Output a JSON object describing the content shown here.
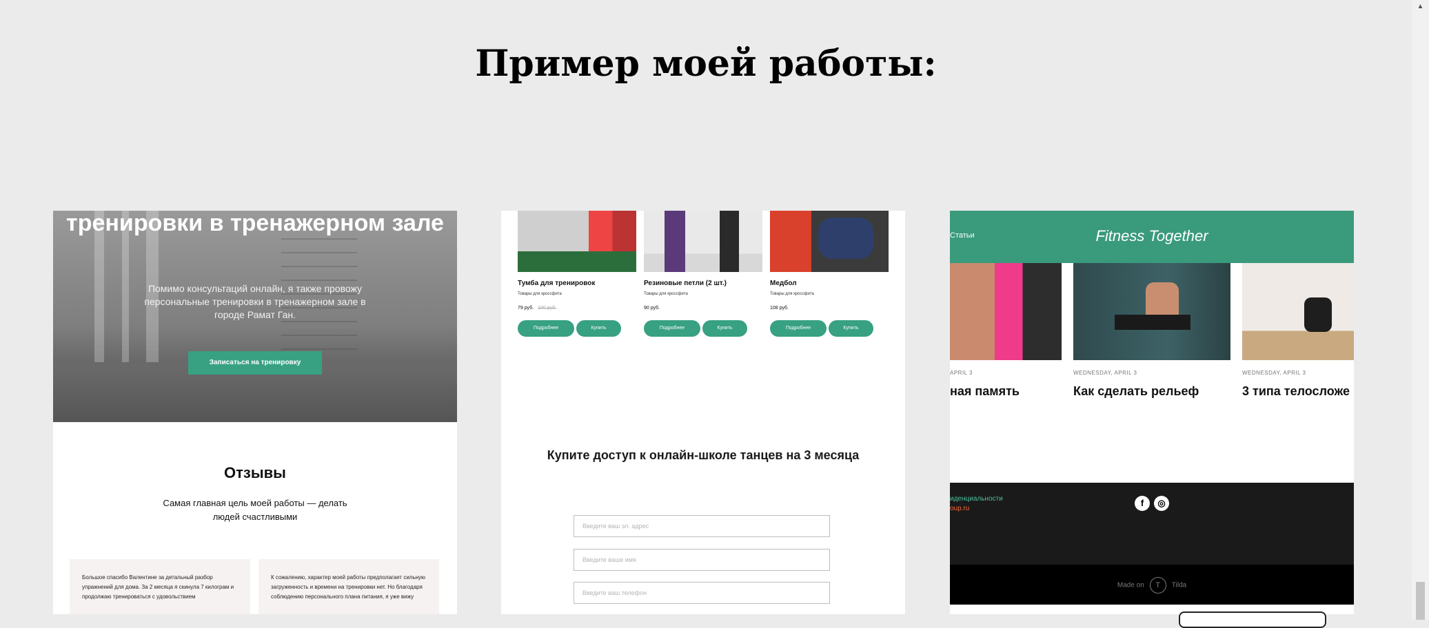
{
  "heading": "Пример моей работы:",
  "card1": {
    "hero_title": "тренировки в тренажерном зале",
    "hero_text": "Помимо консультаций онлайн, я также провожу персональные тренировки в тренажерном зале в городе Рамат Ган.",
    "hero_button": "Записаться на тренировку",
    "reviews_title": "Отзывы",
    "reviews_subtitle": "Самая главная цель моей работы — делать людей счастливыми",
    "reviews": [
      "Большое спасибо Валентине за детальный разбор упражнений для дома. За 2 месяца я скинула 7 килограм и продолжаю тренироваться с удовольствием",
      "К сожалению, характер моей работы предполагает сильную загруженность и времени на тренировки нет. Но благодаря соблюдению персонального плана питания, я уже вижу"
    ]
  },
  "card2": {
    "products": [
      {
        "name": "Тумба для тренировок",
        "category": "Товары для кроссфита",
        "price": "79 руб.",
        "old_price": "100 руб.",
        "btn_details": "Подробнее",
        "btn_buy": "Купить"
      },
      {
        "name": "Резиновые петли (2 шт.)",
        "category": "Товары для кроссфита",
        "price": "90 руб.",
        "old_price": "",
        "btn_details": "Подробнее",
        "btn_buy": "Купить"
      },
      {
        "name": "Медбол",
        "category": "Товары для кроссфита",
        "price": "108 руб.",
        "old_price": "",
        "btn_details": "Подробнее",
        "btn_buy": "Купить"
      }
    ],
    "form_title": "Купите доступ к онлайн-школе танцев на 3 месяца",
    "fields": {
      "email_placeholder": "Введите ваш эл. адрес",
      "name_placeholder": "Введите ваше имя",
      "phone_placeholder": "Введите ваш телефон"
    }
  },
  "card3": {
    "nav_partial": "Статьи",
    "brand": "Fitness Together",
    "articles": [
      {
        "date": "APRIL 3",
        "title": "ная память"
      },
      {
        "date": "WEDNESDAY, APRIL 3",
        "title": "Как сделать рельеф"
      },
      {
        "date": "WEDNESDAY, APRIL 3",
        "title": "3 типа телосложе"
      }
    ],
    "footer_link_1": "иденциальности",
    "footer_link_2": "oup.ru",
    "social_icons": [
      "facebook-icon",
      "instagram-icon"
    ],
    "made_on": "Made on",
    "tilda": "Tilda"
  },
  "colors": {
    "accent": "#37a182",
    "header_green": "#3a9a7c",
    "background": "#ebebeb"
  }
}
